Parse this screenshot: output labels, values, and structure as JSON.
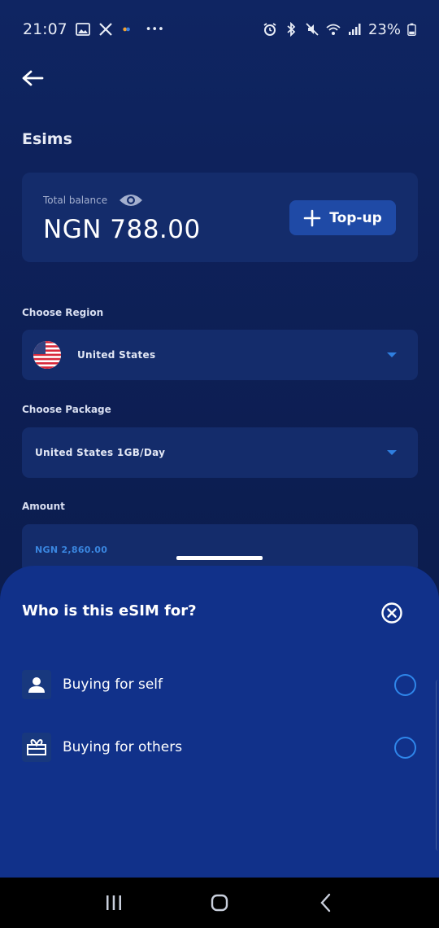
{
  "status_bar": {
    "time": "21:07",
    "battery": "23%",
    "more": "•••",
    "icons_left": [
      "gallery-icon",
      "x-icon",
      "app-dot-icon"
    ],
    "icons_right": [
      "alarm-icon",
      "bluetooth-icon",
      "mute-icon",
      "wifi-icon",
      "signal-icon",
      "battery-icon"
    ]
  },
  "header": {
    "title": "Esims"
  },
  "balance": {
    "label": "Total balance",
    "amount": "NGN 788.00",
    "topup_label": "Top-up"
  },
  "form": {
    "region_label": "Choose Region",
    "region_value": "United States",
    "package_label": "Choose Package",
    "package_value": "United States 1GB/Day",
    "amount_label": "Amount",
    "amount_value": "NGN 2,860.00"
  },
  "sheet": {
    "title": "Who is this eSIM for?",
    "options": [
      {
        "label": "Buying for self",
        "icon": "person-icon",
        "selected": false
      },
      {
        "label": "Buying for others",
        "icon": "gift-icon",
        "selected": false
      }
    ]
  },
  "nav": {
    "buttons": [
      "recent-apps-icon",
      "home-icon",
      "back-nav-icon"
    ]
  },
  "colors": {
    "background": "#0d1f55",
    "card": "#142c6b",
    "sheet": "#11318a",
    "accent": "#2f86ea",
    "button": "#1f4aa6"
  }
}
